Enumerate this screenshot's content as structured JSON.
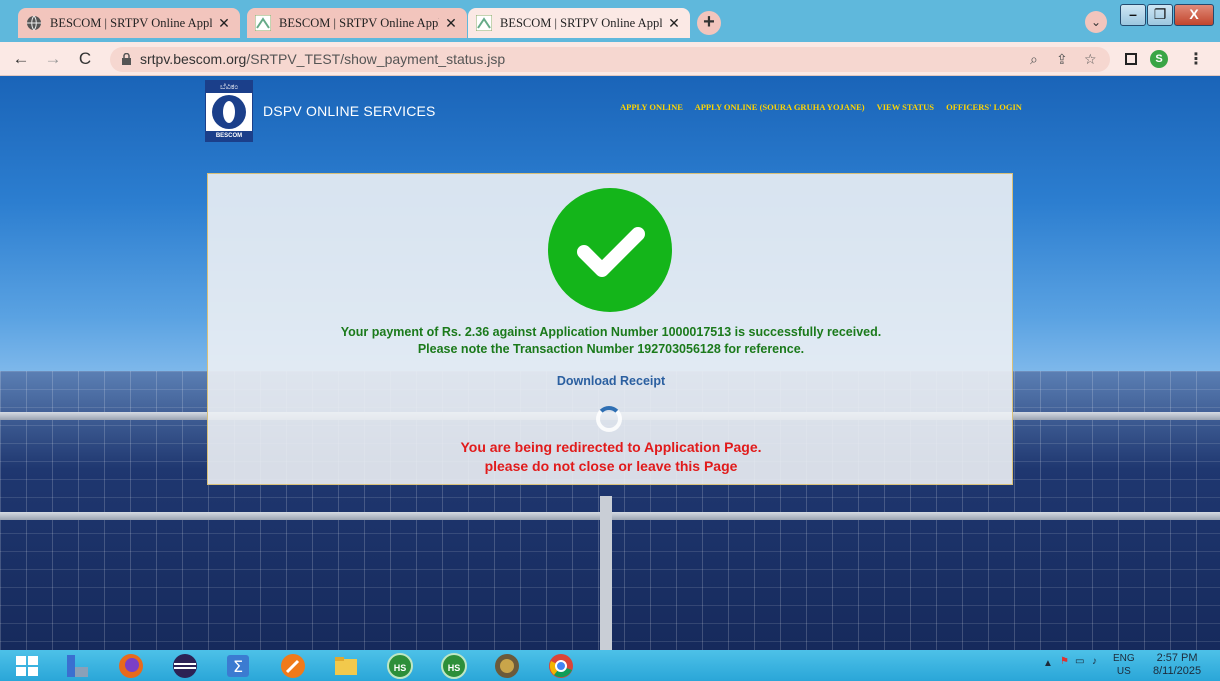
{
  "browser": {
    "tabs": [
      {
        "title": "BESCOM | SRTPV Online Applicat",
        "favicon": "globe-icon",
        "active": false
      },
      {
        "title": "BESCOM | SRTPV Online Applicat",
        "favicon": "bescom-page-icon",
        "active": false
      },
      {
        "title": "BESCOM | SRTPV Online Applicat",
        "favicon": "bescom-page-icon",
        "active": true
      }
    ],
    "new_tab": "+",
    "address": {
      "host": "srtpv.bescom.org",
      "path": "/SRTPV_TEST/show_payment_status.jsp"
    },
    "profile_initial": "S",
    "window_controls": {
      "minimize": "–",
      "maximize": "❐",
      "close": "X"
    }
  },
  "site": {
    "logo": {
      "top_text": "ಬೆವಿಕಂ",
      "bottom_text": "BESCOM"
    },
    "title": "DSPV ONLINE SERVICES",
    "nav": [
      "APPLY ONLINE",
      "APPLY ONLINE (SOURA GRUHA YOJANE)",
      "VIEW STATUS",
      "OFFICERS' LOGIN"
    ]
  },
  "status": {
    "message_line1": "Your payment of Rs. 2.36 against Application Number 1000017513 is successfully received.",
    "message_line2": "Please note the Transaction Number 192703056128 for reference.",
    "download_link": "Download Receipt",
    "redirect_line1": "You are being redirected to Application Page.",
    "redirect_line2": "please do not close or leave this Page",
    "success_color": "#14b51a",
    "redirect_color": "#e11b1b"
  },
  "taskbar": {
    "apps": [
      "start-icon",
      "file-manager-icon",
      "firefox-icon",
      "eclipse-icon",
      "sigma-icon",
      "pencil-app-icon",
      "folder-icon",
      "hs-app-icon",
      "hs-app-icon",
      "badge-app-icon",
      "chrome-icon"
    ],
    "hs_label": "HS",
    "lang_top": "ENG",
    "lang_bottom": "US",
    "time": "2:57 PM",
    "date": "8/11/2025"
  }
}
